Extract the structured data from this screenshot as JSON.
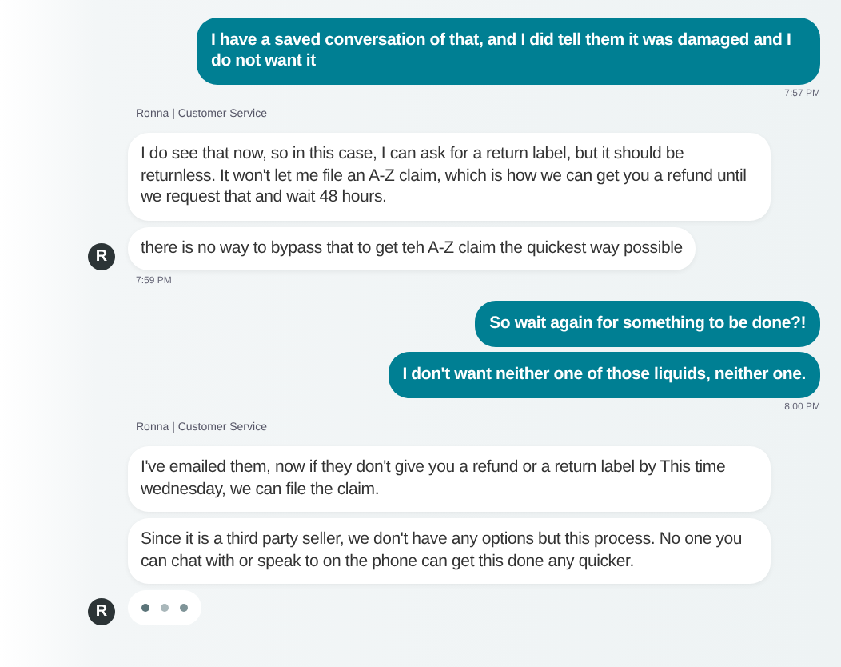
{
  "groups": [
    {
      "kind": "outgoing",
      "messages": [
        "I have a saved conversation of that, and I did tell them it was damaged and I do not want it"
      ],
      "time": "7:57 PM"
    },
    {
      "kind": "incoming",
      "sender": "Ronna | Customer Service",
      "avatar": "R",
      "messages": [
        " I do see that now, so in this case, I can ask for a return label, but it should be returnless.  It won't let me file an A-Z claim, which is how we can get you a refund until we request that and wait 48 hours.",
        "there is no way to bypass that to get teh A-Z claim the quickest way possible"
      ],
      "time": "7:59 PM",
      "typing": false
    },
    {
      "kind": "outgoing",
      "messages": [
        "So wait again for something to be done?!",
        "I don't want neither one of those liquids, neither one."
      ],
      "time": "8:00 PM"
    },
    {
      "kind": "incoming",
      "sender": "Ronna | Customer Service",
      "avatar": "R",
      "messages": [
        "I've emailed them, now if they don't give you a refund or a return label by This time wednesday, we can file the claim.",
        "Since it is a third party seller, we don't have any options but this process.  No one you can chat with or speak to on the phone can get this done any quicker."
      ],
      "typing": true
    }
  ]
}
